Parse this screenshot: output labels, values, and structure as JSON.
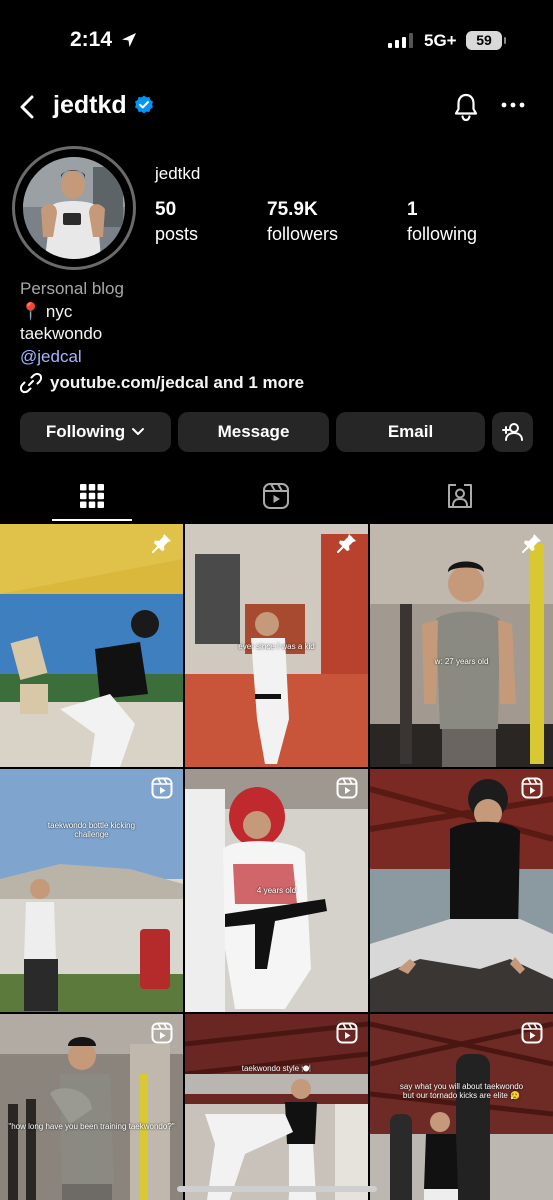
{
  "status_bar": {
    "time": "2:14",
    "network": "5G+",
    "battery": "59"
  },
  "header": {
    "username": "jedtkd"
  },
  "profile": {
    "display_name": "jedtkd",
    "posts_count": "50",
    "posts_label": "posts",
    "followers_count": "75.9K",
    "followers_label": "followers",
    "following_count": "1",
    "following_label": "following"
  },
  "bio": {
    "category": "Personal blog",
    "location": "📍 nyc",
    "line2": "taekwondo",
    "mention": "@jedcal",
    "link": "youtube.com/jedcal and 1 more"
  },
  "buttons": {
    "following": "Following",
    "message": "Message",
    "email": "Email"
  },
  "tabs": [
    "grid-icon",
    "reels-icon",
    "tagged-icon"
  ],
  "posts": [
    {
      "overlay": "",
      "badge": "pin"
    },
    {
      "overlay": "ever since I was a kid",
      "badge": "pin"
    },
    {
      "overlay": "w: 27 years old",
      "badge": "pin"
    },
    {
      "overlay": "taekwondo bottle kicking challenge",
      "badge": "reel"
    },
    {
      "overlay": "4 years old",
      "badge": "reel"
    },
    {
      "overlay": "",
      "badge": "reel"
    },
    {
      "overlay": "\"how long have you been training taekwondo?\"",
      "badge": "reel"
    },
    {
      "overlay": "taekwondo style 🍽️",
      "badge": "reel"
    },
    {
      "overlay": "say what you will about taekwondo but our tornado kicks are elite 😮‍💨",
      "badge": "reel"
    }
  ],
  "colors": {
    "background": "#000000",
    "button": "#262626",
    "verified": "#0095f6",
    "mention": "#a3b6ff"
  }
}
